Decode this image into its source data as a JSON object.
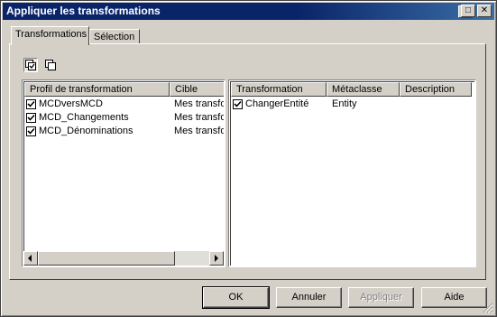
{
  "window": {
    "title": "Appliquer les transformations",
    "controls": {
      "minimize": "_",
      "maximize": "□",
      "close": "✕"
    }
  },
  "tabs": [
    {
      "label": "Transformations",
      "active": true
    },
    {
      "label": "Sélection",
      "active": false
    }
  ],
  "toolbar": {
    "icons": [
      "select-all-icon",
      "deselect-all-icon"
    ]
  },
  "left_list": {
    "columns": [
      "Profil de transformation",
      "Cible"
    ],
    "rows": [
      {
        "checked": true,
        "name": "MCDversMCD",
        "target": "Mes transfo"
      },
      {
        "checked": true,
        "name": "MCD_Changements",
        "target": "Mes transfo"
      },
      {
        "checked": true,
        "name": "MCD_Dénominations",
        "target": "Mes transfo"
      }
    ]
  },
  "right_list": {
    "columns": [
      "Transformation",
      "Métaclasse",
      "Description"
    ],
    "rows": [
      {
        "checked": true,
        "name": "ChangerEntité",
        "metaclass": "Entity",
        "description": ""
      }
    ]
  },
  "buttons": {
    "ok": "OK",
    "cancel": "Annuler",
    "apply": "Appliquer",
    "help": "Aide"
  }
}
